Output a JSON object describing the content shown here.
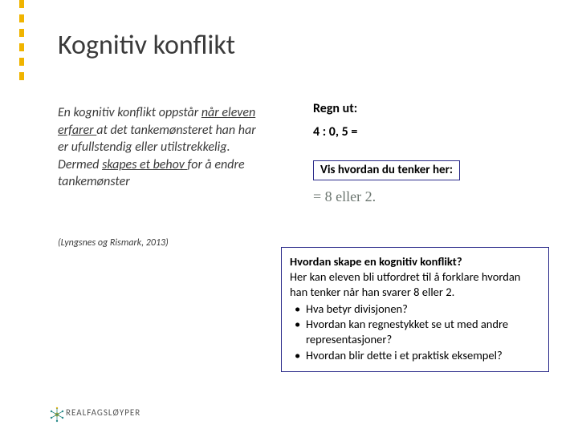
{
  "title": "Kognitiv konflikt",
  "body": {
    "pre": "En kognitiv konflikt oppstår ",
    "u1": "når eleven erfarer ",
    "mid": "at det tankemønsteret han har er ufullstendig eller utilstrekkelig. Dermed ",
    "u2": "skapes et behov ",
    "post": "for å endre tankemønster"
  },
  "citation": "(Lyngsnes og Rismark, 2013)",
  "math": {
    "title": "Regn ut:",
    "equation": "4 : 0, 5 =",
    "thinkLabel": "Vis hvordan du tenker her:",
    "handwritten": "= 8  eller  2."
  },
  "info": {
    "q": "Hvordan skape en kognitiv konflikt?",
    "intro": "Her kan eleven bli utfordret til å forklare hvordan han tenker når han svarer 8 eller 2.",
    "bullets": [
      "Hva betyr divisjonen?",
      "Hvordan kan regnestykket se ut med andre representasjoner?",
      "Hvordan blir dette i et praktisk eksempel?"
    ]
  },
  "logo": "REALFAGSLØYPER"
}
